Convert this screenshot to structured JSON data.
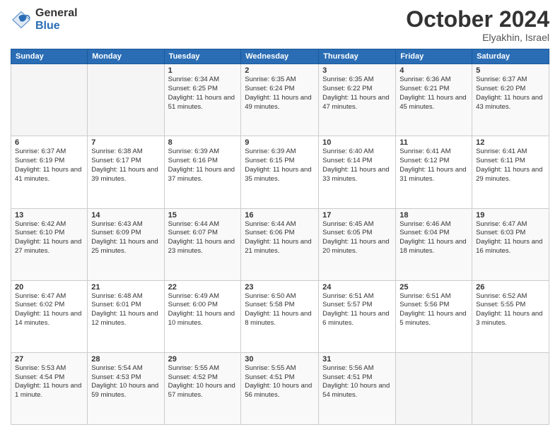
{
  "logo": {
    "general": "General",
    "blue": "Blue"
  },
  "title": "October 2024",
  "location": "Elyakhin, Israel",
  "days_header": [
    "Sunday",
    "Monday",
    "Tuesday",
    "Wednesday",
    "Thursday",
    "Friday",
    "Saturday"
  ],
  "weeks": [
    [
      {
        "day": "",
        "info": ""
      },
      {
        "day": "",
        "info": ""
      },
      {
        "day": "1",
        "info": "Sunrise: 6:34 AM\nSunset: 6:25 PM\nDaylight: 11 hours and 51 minutes."
      },
      {
        "day": "2",
        "info": "Sunrise: 6:35 AM\nSunset: 6:24 PM\nDaylight: 11 hours and 49 minutes."
      },
      {
        "day": "3",
        "info": "Sunrise: 6:35 AM\nSunset: 6:22 PM\nDaylight: 11 hours and 47 minutes."
      },
      {
        "day": "4",
        "info": "Sunrise: 6:36 AM\nSunset: 6:21 PM\nDaylight: 11 hours and 45 minutes."
      },
      {
        "day": "5",
        "info": "Sunrise: 6:37 AM\nSunset: 6:20 PM\nDaylight: 11 hours and 43 minutes."
      }
    ],
    [
      {
        "day": "6",
        "info": "Sunrise: 6:37 AM\nSunset: 6:19 PM\nDaylight: 11 hours and 41 minutes."
      },
      {
        "day": "7",
        "info": "Sunrise: 6:38 AM\nSunset: 6:17 PM\nDaylight: 11 hours and 39 minutes."
      },
      {
        "day": "8",
        "info": "Sunrise: 6:39 AM\nSunset: 6:16 PM\nDaylight: 11 hours and 37 minutes."
      },
      {
        "day": "9",
        "info": "Sunrise: 6:39 AM\nSunset: 6:15 PM\nDaylight: 11 hours and 35 minutes."
      },
      {
        "day": "10",
        "info": "Sunrise: 6:40 AM\nSunset: 6:14 PM\nDaylight: 11 hours and 33 minutes."
      },
      {
        "day": "11",
        "info": "Sunrise: 6:41 AM\nSunset: 6:12 PM\nDaylight: 11 hours and 31 minutes."
      },
      {
        "day": "12",
        "info": "Sunrise: 6:41 AM\nSunset: 6:11 PM\nDaylight: 11 hours and 29 minutes."
      }
    ],
    [
      {
        "day": "13",
        "info": "Sunrise: 6:42 AM\nSunset: 6:10 PM\nDaylight: 11 hours and 27 minutes."
      },
      {
        "day": "14",
        "info": "Sunrise: 6:43 AM\nSunset: 6:09 PM\nDaylight: 11 hours and 25 minutes."
      },
      {
        "day": "15",
        "info": "Sunrise: 6:44 AM\nSunset: 6:07 PM\nDaylight: 11 hours and 23 minutes."
      },
      {
        "day": "16",
        "info": "Sunrise: 6:44 AM\nSunset: 6:06 PM\nDaylight: 11 hours and 21 minutes."
      },
      {
        "day": "17",
        "info": "Sunrise: 6:45 AM\nSunset: 6:05 PM\nDaylight: 11 hours and 20 minutes."
      },
      {
        "day": "18",
        "info": "Sunrise: 6:46 AM\nSunset: 6:04 PM\nDaylight: 11 hours and 18 minutes."
      },
      {
        "day": "19",
        "info": "Sunrise: 6:47 AM\nSunset: 6:03 PM\nDaylight: 11 hours and 16 minutes."
      }
    ],
    [
      {
        "day": "20",
        "info": "Sunrise: 6:47 AM\nSunset: 6:02 PM\nDaylight: 11 hours and 14 minutes."
      },
      {
        "day": "21",
        "info": "Sunrise: 6:48 AM\nSunset: 6:01 PM\nDaylight: 11 hours and 12 minutes."
      },
      {
        "day": "22",
        "info": "Sunrise: 6:49 AM\nSunset: 6:00 PM\nDaylight: 11 hours and 10 minutes."
      },
      {
        "day": "23",
        "info": "Sunrise: 6:50 AM\nSunset: 5:58 PM\nDaylight: 11 hours and 8 minutes."
      },
      {
        "day": "24",
        "info": "Sunrise: 6:51 AM\nSunset: 5:57 PM\nDaylight: 11 hours and 6 minutes."
      },
      {
        "day": "25",
        "info": "Sunrise: 6:51 AM\nSunset: 5:56 PM\nDaylight: 11 hours and 5 minutes."
      },
      {
        "day": "26",
        "info": "Sunrise: 6:52 AM\nSunset: 5:55 PM\nDaylight: 11 hours and 3 minutes."
      }
    ],
    [
      {
        "day": "27",
        "info": "Sunrise: 5:53 AM\nSunset: 4:54 PM\nDaylight: 11 hours and 1 minute."
      },
      {
        "day": "28",
        "info": "Sunrise: 5:54 AM\nSunset: 4:53 PM\nDaylight: 10 hours and 59 minutes."
      },
      {
        "day": "29",
        "info": "Sunrise: 5:55 AM\nSunset: 4:52 PM\nDaylight: 10 hours and 57 minutes."
      },
      {
        "day": "30",
        "info": "Sunrise: 5:55 AM\nSunset: 4:51 PM\nDaylight: 10 hours and 56 minutes."
      },
      {
        "day": "31",
        "info": "Sunrise: 5:56 AM\nSunset: 4:51 PM\nDaylight: 10 hours and 54 minutes."
      },
      {
        "day": "",
        "info": ""
      },
      {
        "day": "",
        "info": ""
      }
    ]
  ]
}
